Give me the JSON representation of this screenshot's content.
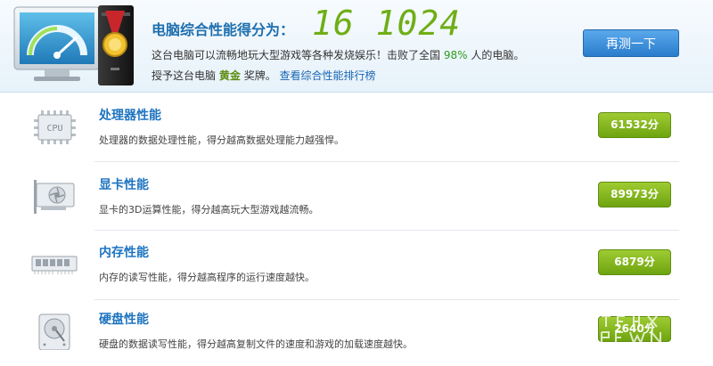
{
  "header": {
    "score_label": "电脑综合性能得分为：",
    "score_value": "16 1024",
    "desc_prefix": "这台电脑可以流畅地玩大型游戏等各种发烧娱乐！击败了全国",
    "desc_percent": "98%",
    "desc_suffix": "人的电脑。",
    "award_prefix": "授予这台电脑",
    "award_medal": "黄金",
    "award_suffix": "奖牌。",
    "ranking_link": "查看综合性能排行榜",
    "retest_button": "再测一下"
  },
  "rows": [
    {
      "title": "处理器性能",
      "desc": "处理器的数据处理性能，得分越高数据处理能力越强悍。",
      "score": "61532分",
      "icon": "cpu-icon",
      "icon_text": "CPU"
    },
    {
      "title": "显卡性能",
      "desc": "显卡的3D运算性能，得分越高玩大型游戏越流畅。",
      "score": "89973分",
      "icon": "graphics-card-icon"
    },
    {
      "title": "内存性能",
      "desc": "内存的读写性能，得分越高程序的运行速度越快。",
      "score": "6879分",
      "icon": "memory-icon"
    },
    {
      "title": "硬盘性能",
      "desc": "硬盘的数据读写性能，得分越高复制文件的速度和游戏的加载速度越快。",
      "score": "2640分",
      "icon": "hard-disk-icon"
    }
  ],
  "colors": {
    "accent_blue": "#1e74c0",
    "score_green": "#6fae16",
    "badge_green": "#7fb21a",
    "button_blue": "#3a8bd9"
  }
}
